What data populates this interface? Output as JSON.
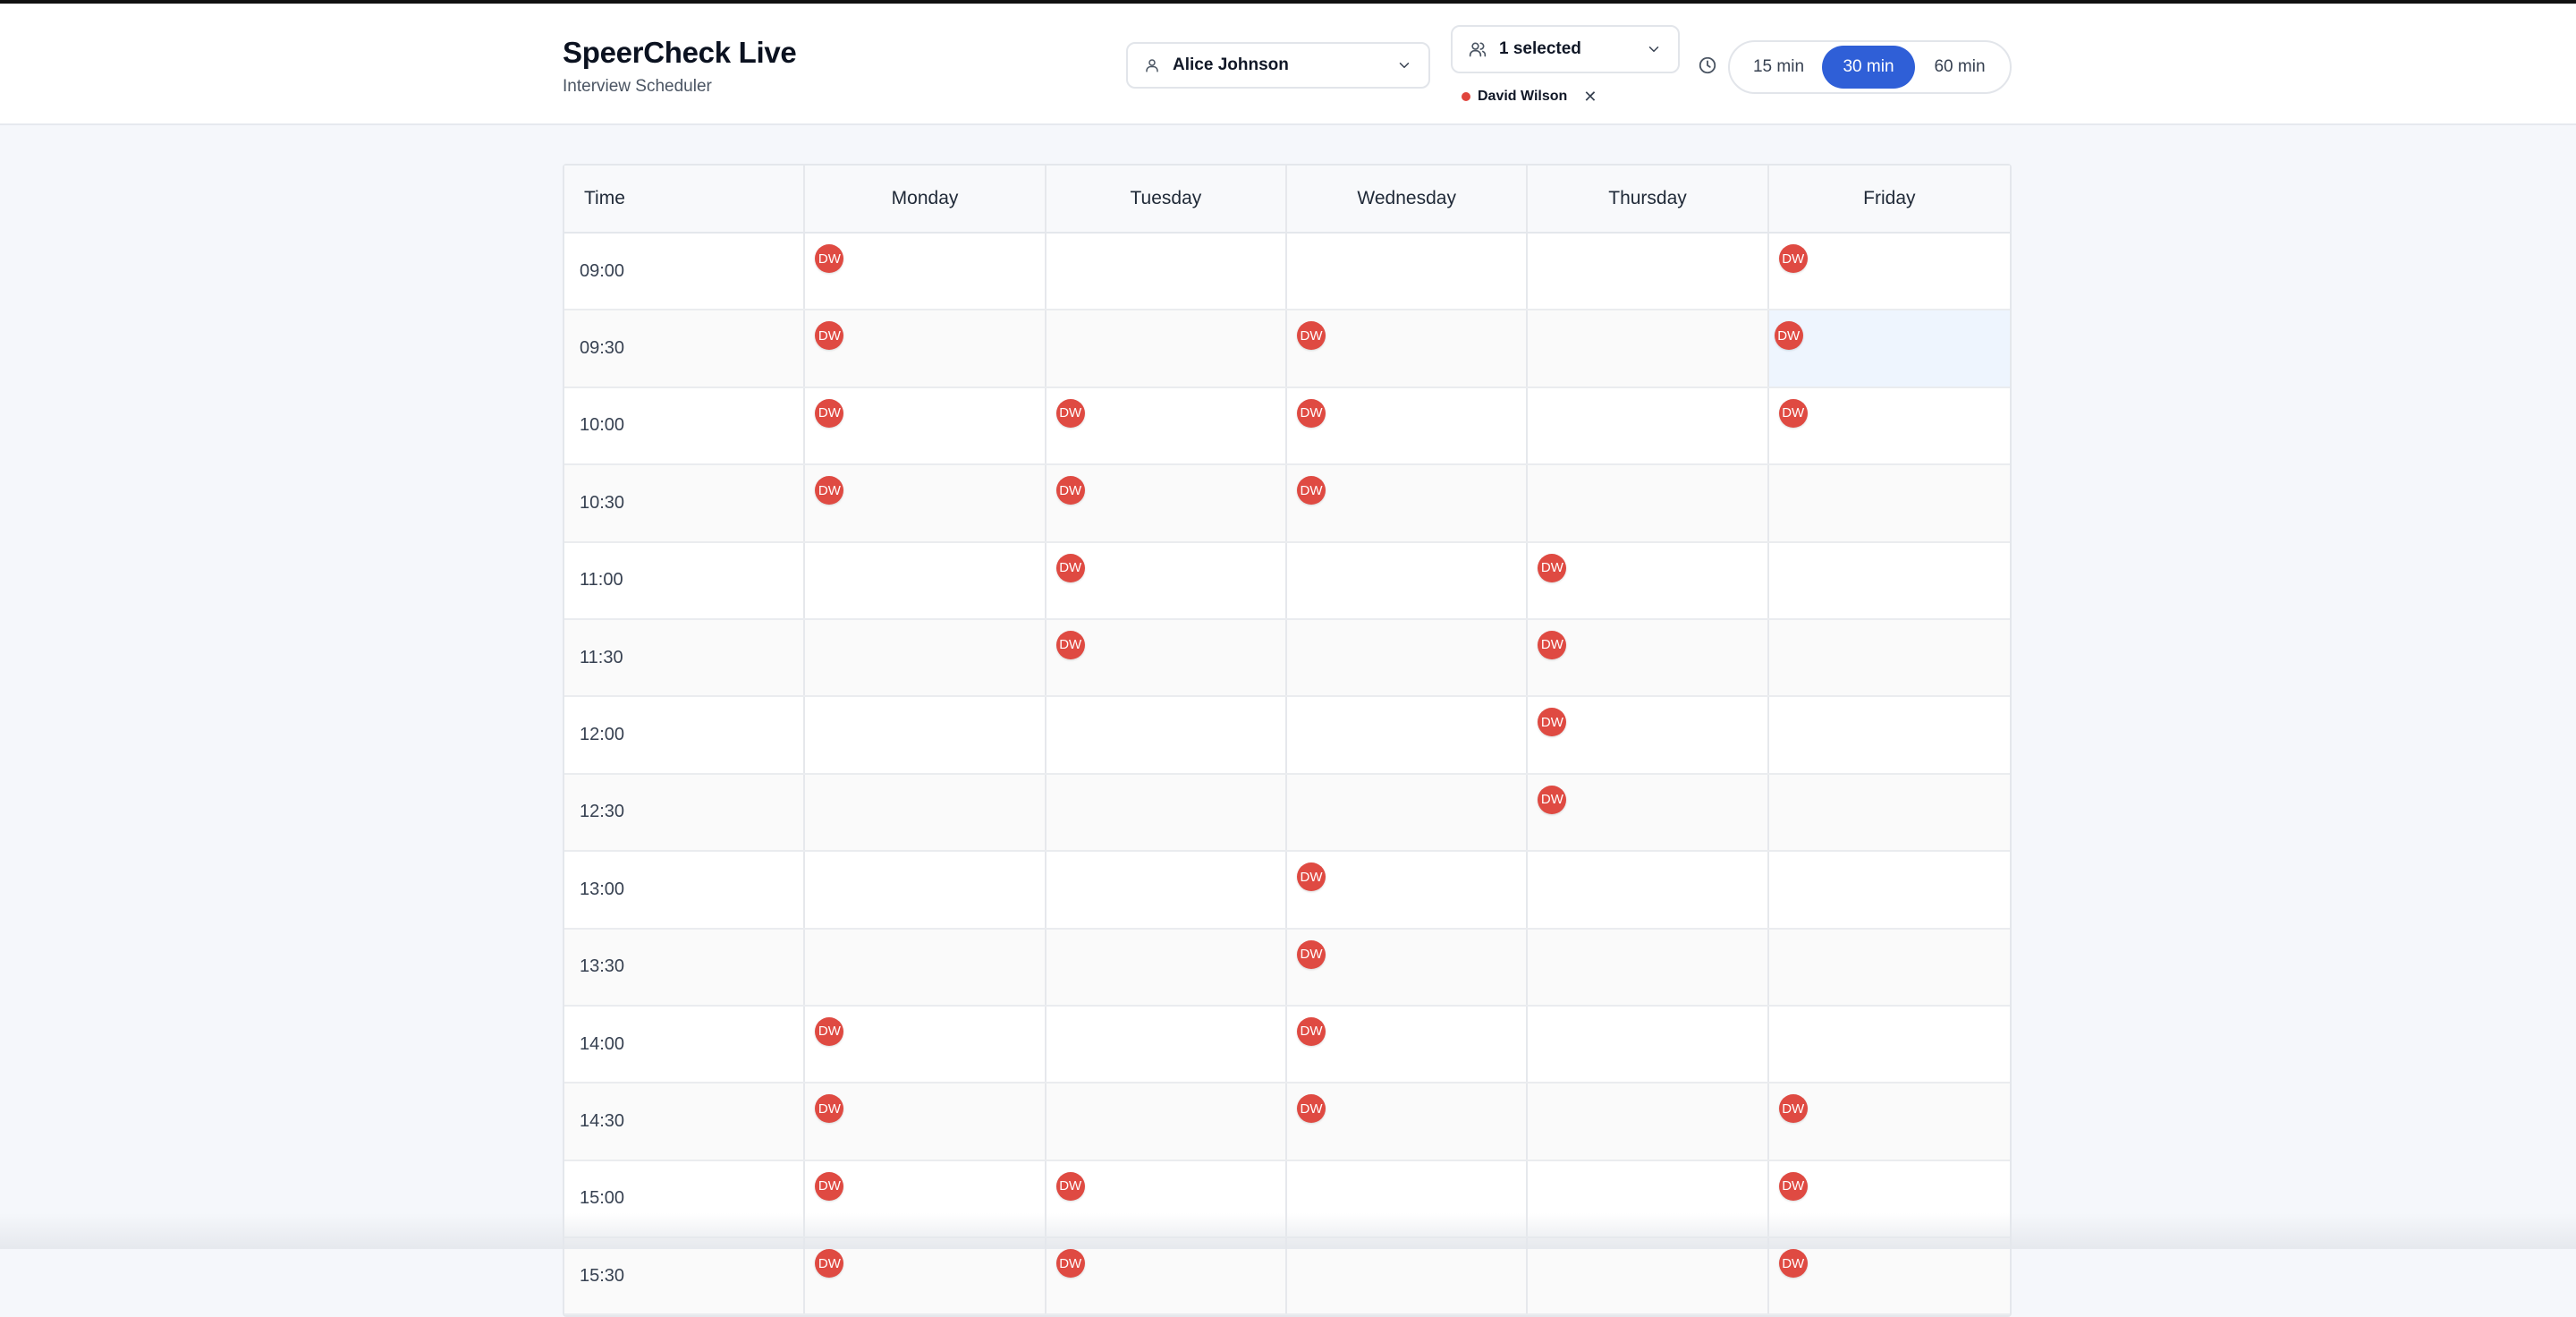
{
  "app": {
    "title": "SpeerCheck Live",
    "subtitle": "Interview Scheduler"
  },
  "interviewer_select": {
    "value": "Alice Johnson",
    "icon": "user-icon"
  },
  "candidate_select": {
    "value": "1 selected",
    "icon": "users-icon"
  },
  "selected_candidates": [
    {
      "name": "David Wilson",
      "color": "#e0443c"
    }
  ],
  "durations": {
    "options": [
      "15 min",
      "30 min",
      "60 min"
    ],
    "selected": "30 min"
  },
  "colors": {
    "accent": "#2f5fd7",
    "badge": "#df4a42"
  },
  "calendar": {
    "time_header": "Time",
    "days": [
      "Monday",
      "Tuesday",
      "Wednesday",
      "Thursday",
      "Friday"
    ],
    "badge_text": "DW",
    "highlighted_slot": {
      "time": "09:30",
      "day": "Friday"
    },
    "rows": [
      {
        "time": "09:00",
        "booked": [
          true,
          false,
          false,
          false,
          true
        ]
      },
      {
        "time": "09:30",
        "booked": [
          true,
          false,
          true,
          false,
          true
        ]
      },
      {
        "time": "10:00",
        "booked": [
          true,
          true,
          true,
          false,
          true
        ]
      },
      {
        "time": "10:30",
        "booked": [
          true,
          true,
          true,
          false,
          false
        ]
      },
      {
        "time": "11:00",
        "booked": [
          false,
          true,
          false,
          true,
          false
        ]
      },
      {
        "time": "11:30",
        "booked": [
          false,
          true,
          false,
          true,
          false
        ]
      },
      {
        "time": "12:00",
        "booked": [
          false,
          false,
          false,
          true,
          false
        ]
      },
      {
        "time": "12:30",
        "booked": [
          false,
          false,
          false,
          true,
          false
        ]
      },
      {
        "time": "13:00",
        "booked": [
          false,
          false,
          true,
          false,
          false
        ]
      },
      {
        "time": "13:30",
        "booked": [
          false,
          false,
          true,
          false,
          false
        ]
      },
      {
        "time": "14:00",
        "booked": [
          true,
          false,
          true,
          false,
          false
        ]
      },
      {
        "time": "14:30",
        "booked": [
          true,
          false,
          true,
          false,
          true
        ]
      },
      {
        "time": "15:00",
        "booked": [
          true,
          true,
          false,
          false,
          true
        ]
      },
      {
        "time": "15:30",
        "booked": [
          true,
          true,
          false,
          false,
          true
        ]
      }
    ]
  }
}
